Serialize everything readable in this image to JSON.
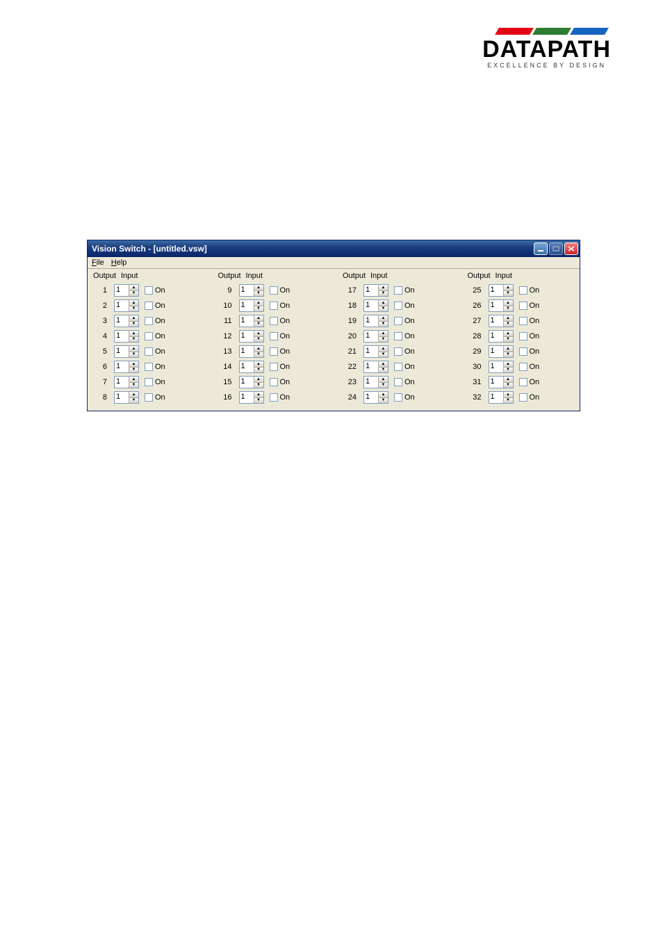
{
  "logo": {
    "name": "DATAPATH",
    "tagline": "EXCELLENCE BY DESIGN"
  },
  "window": {
    "title": "Vision Switch - [untitled.vsw]"
  },
  "menu": {
    "file": "File",
    "help": "Help"
  },
  "headers": {
    "output": "Output",
    "input": "Input"
  },
  "on_label": "On",
  "columns": [
    {
      "rows": [
        {
          "output": "1",
          "input": "1"
        },
        {
          "output": "2",
          "input": "1"
        },
        {
          "output": "3",
          "input": "1"
        },
        {
          "output": "4",
          "input": "1"
        },
        {
          "output": "5",
          "input": "1"
        },
        {
          "output": "6",
          "input": "1"
        },
        {
          "output": "7",
          "input": "1"
        },
        {
          "output": "8",
          "input": "1"
        }
      ]
    },
    {
      "rows": [
        {
          "output": "9",
          "input": "1"
        },
        {
          "output": "10",
          "input": "1"
        },
        {
          "output": "11",
          "input": "1"
        },
        {
          "output": "12",
          "input": "1"
        },
        {
          "output": "13",
          "input": "1"
        },
        {
          "output": "14",
          "input": "1"
        },
        {
          "output": "15",
          "input": "1"
        },
        {
          "output": "16",
          "input": "1"
        }
      ]
    },
    {
      "rows": [
        {
          "output": "17",
          "input": "1"
        },
        {
          "output": "18",
          "input": "1"
        },
        {
          "output": "19",
          "input": "1"
        },
        {
          "output": "20",
          "input": "1"
        },
        {
          "output": "21",
          "input": "1"
        },
        {
          "output": "22",
          "input": "1"
        },
        {
          "output": "23",
          "input": "1"
        },
        {
          "output": "24",
          "input": "1"
        }
      ]
    },
    {
      "rows": [
        {
          "output": "25",
          "input": "1"
        },
        {
          "output": "26",
          "input": "1"
        },
        {
          "output": "27",
          "input": "1"
        },
        {
          "output": "28",
          "input": "1"
        },
        {
          "output": "29",
          "input": "1"
        },
        {
          "output": "30",
          "input": "1"
        },
        {
          "output": "31",
          "input": "1"
        },
        {
          "output": "32",
          "input": "1"
        }
      ]
    }
  ]
}
